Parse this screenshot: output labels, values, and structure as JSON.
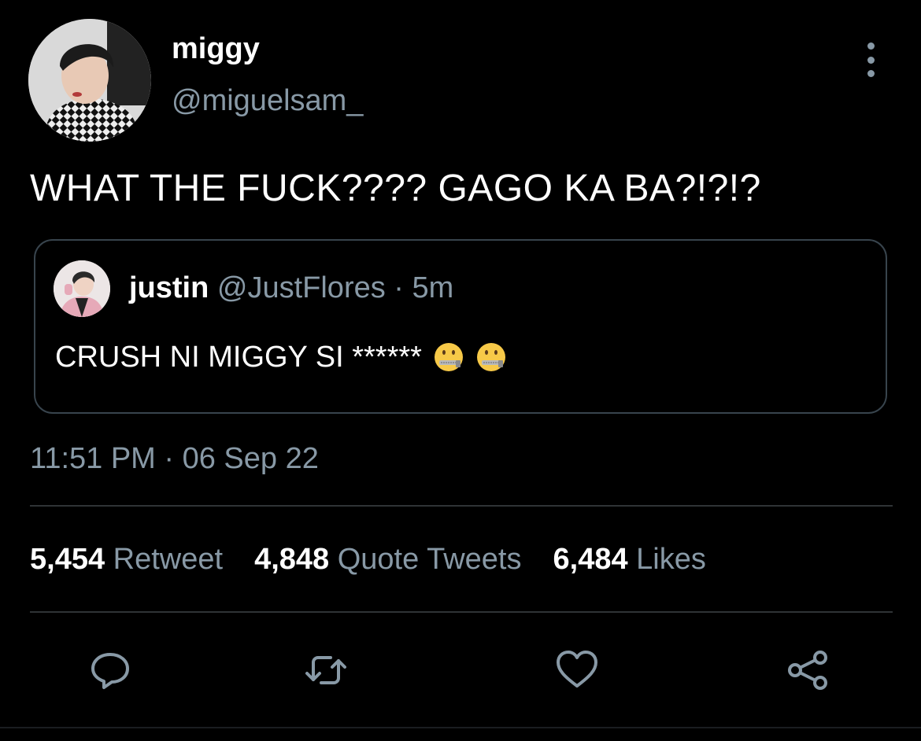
{
  "author": {
    "display_name": "miggy",
    "handle": "@miguelsam_",
    "avatar_icon": "profile-photo"
  },
  "tweet": {
    "text": "WHAT THE FUCK???? GAGO KA BA?!?!?",
    "timestamp": "11:51 PM · 06 Sep 22"
  },
  "quoted_tweet": {
    "display_name": "justin",
    "handle": "@JustFlores",
    "separator": "·",
    "time": "5m",
    "text": "CRUSH NI MIGGY SI ******",
    "emojis": [
      "zipper-mouth-face-icon",
      "zipper-mouth-face-icon"
    ]
  },
  "stats": [
    {
      "count": "5,454",
      "label": "Retweet"
    },
    {
      "count": "4,848",
      "label": "Quote Tweets"
    },
    {
      "count": "6,484",
      "label": "Likes"
    }
  ],
  "actions": [
    "reply-icon",
    "retweet-icon",
    "like-icon",
    "share-icon"
  ],
  "colors": {
    "background": "#000000",
    "text_primary": "#ffffff",
    "text_secondary": "#8899a6",
    "border": "#38444d",
    "divider": "#2f3336"
  }
}
